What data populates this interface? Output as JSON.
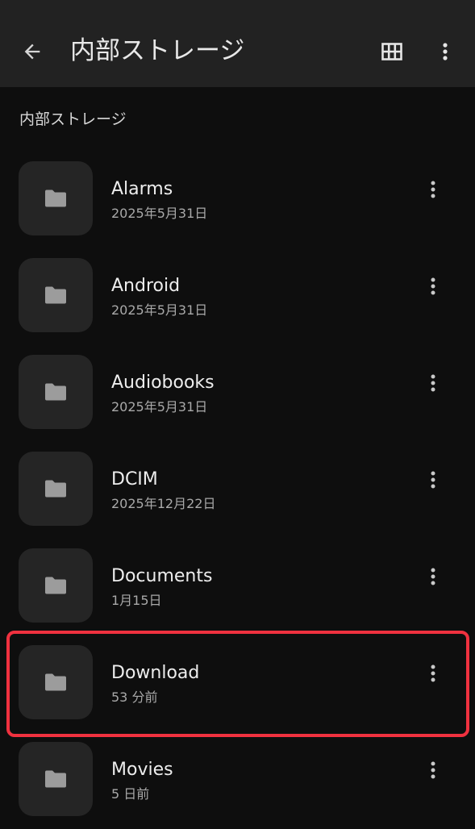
{
  "appbar": {
    "title": "内部ストレージ",
    "back_icon": "arrow-back-icon",
    "grid_icon": "grid-view-icon",
    "more_icon": "more-vert-icon"
  },
  "breadcrumb": "内部ストレージ",
  "items": [
    {
      "name": "Alarms",
      "meta": "2025年5月31日"
    },
    {
      "name": "Android",
      "meta": "2025年5月31日"
    },
    {
      "name": "Audiobooks",
      "meta": "2025年5月31日"
    },
    {
      "name": "DCIM",
      "meta": "2025年12月22日"
    },
    {
      "name": "Documents",
      "meta": "1月15日"
    },
    {
      "name": "Download",
      "meta": "53 分前"
    },
    {
      "name": "Movies",
      "meta": "5 日前"
    }
  ],
  "colors": {
    "background": "#0e0e0e",
    "appbar": "#222222",
    "highlight": "#f0313f"
  }
}
